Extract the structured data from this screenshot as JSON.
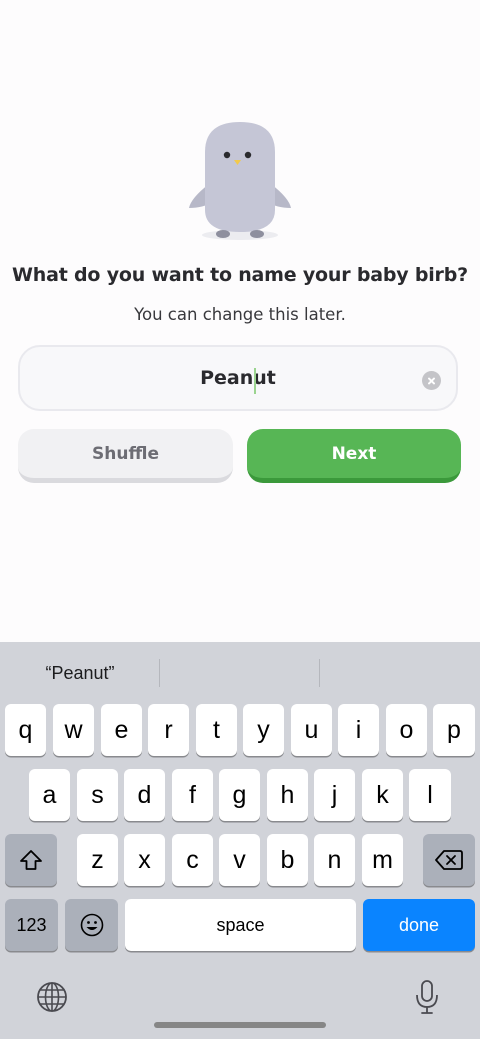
{
  "onboarding": {
    "title": "What do you want to name your baby birb?",
    "subtitle": "You can change this later.",
    "name_value": "Peanut",
    "shuffle_label": "Shuffle",
    "next_label": "Next",
    "accent_color": "#57b655"
  },
  "keyboard": {
    "suggestions": [
      "“Peanut”",
      "",
      ""
    ],
    "row1": [
      "q",
      "w",
      "e",
      "r",
      "t",
      "y",
      "u",
      "i",
      "o",
      "p"
    ],
    "row2": [
      "a",
      "s",
      "d",
      "f",
      "g",
      "h",
      "j",
      "k",
      "l"
    ],
    "row3": [
      "z",
      "x",
      "c",
      "v",
      "b",
      "n",
      "m"
    ],
    "numbers_label": "123",
    "space_label": "space",
    "done_label": "done",
    "icons": [
      "shift-icon",
      "backspace-icon",
      "emoji-icon",
      "globe-icon",
      "microphone-icon"
    ]
  }
}
